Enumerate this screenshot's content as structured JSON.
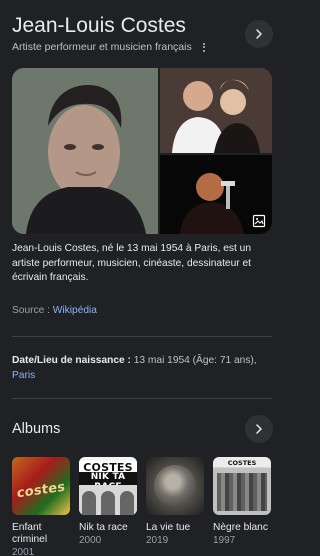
{
  "entity": {
    "title": "Jean-Louis Costes",
    "subtitle": "Artiste performeur et musicien français"
  },
  "description": {
    "text": "Jean-Louis Costes, né le 13 mai 1954 à Paris, est un artiste performeur, musicien, cinéaste, dessinateur et écrivain français.",
    "source_label": "Source :",
    "source_link": "Wikipédia"
  },
  "facts": {
    "born_label": "Date/Lieu de naissance :",
    "born_value": "13 mai 1954 (Âge: 71 ans),",
    "born_place": "Paris"
  },
  "albums": {
    "title": "Albums",
    "items": [
      {
        "name": "Enfant criminel",
        "year": "2001",
        "cover_text": "costes"
      },
      {
        "name": "Nik ta race",
        "year": "2000",
        "cover_text": "COSTES",
        "cover_subtext": "NIK TA RACE"
      },
      {
        "name": "La vie tue",
        "year": "2019"
      },
      {
        "name": "Nègre blanc",
        "year": "1997",
        "cover_text": "COSTES"
      }
    ]
  },
  "icons": {
    "chevron": "chevron-right-icon",
    "more": "more-vert-icon",
    "image": "image-icon"
  }
}
